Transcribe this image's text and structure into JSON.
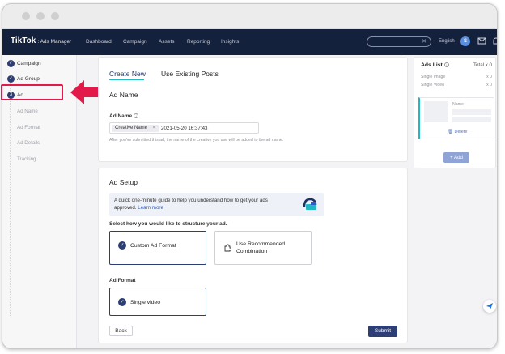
{
  "topnav": {
    "logo": "TikTok",
    "logo_sub": ": Ads Manager",
    "links": [
      "Dashboard",
      "Campaign",
      "Assets",
      "Reporting",
      "Insights"
    ],
    "language": "English",
    "avatar_initial": "S"
  },
  "sidebar": {
    "items": [
      {
        "label": "Campaign",
        "icon": "check-circle-icon",
        "step": "✓"
      },
      {
        "label": "Ad Group",
        "icon": "check-circle-icon",
        "step": "✓"
      },
      {
        "label": "Ad",
        "icon": "step-number-icon",
        "step": "3"
      }
    ],
    "sub_items": [
      "Ad Name",
      "Ad Format",
      "Ad Details",
      "Tracking"
    ]
  },
  "tabs": [
    "Create New",
    "Use Existing Posts"
  ],
  "ad_name_section": {
    "heading": "Ad Name",
    "field_label": "Ad Name",
    "chip": "Creative Name_",
    "chip_close": "×",
    "date_value": "2021-05-20 16:37:43",
    "hint": "After you've submitted this ad, the name of the creative you use will be added to the ad name."
  },
  "ad_setup": {
    "heading": "Ad Setup",
    "guide_text": "A quick one-minute guide to help you understand how to get your ads approved.",
    "guide_link": "Learn more",
    "structure_prompt": "Select how you would like to structure your ad.",
    "options": [
      "Custom Ad Format",
      "Use Recommended Combination"
    ],
    "format_label": "Ad Format",
    "format_option": "Single video"
  },
  "buttons": {
    "back": "Back",
    "submit": "Submit"
  },
  "ads_list": {
    "title": "Ads List",
    "total": "Total x 0",
    "rows": [
      {
        "label": "Single Image",
        "count": "x 0"
      },
      {
        "label": "Single Video",
        "count": "x 0"
      }
    ],
    "name_label": "Name",
    "delete_label": "Delete",
    "add_label": "+ Add"
  },
  "colors": {
    "nav_bg": "#14213d",
    "primary": "#2c3e73",
    "accent": "#1fb8c3",
    "highlight": "#e3194a"
  }
}
